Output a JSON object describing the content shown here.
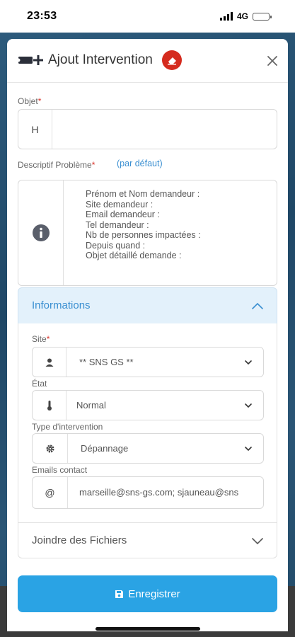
{
  "status_bar": {
    "time": "23:53",
    "network": "4G",
    "icons": [
      "signal-icon",
      "battery-icon"
    ]
  },
  "modal": {
    "title": "Ajout Intervention",
    "icons": [
      "ticket-add-icon",
      "eraser-icon",
      "close-icon"
    ],
    "objet": {
      "label": "Objet",
      "required_mark": "*",
      "addon_text": "H",
      "value": ""
    },
    "descriptif": {
      "label": "Descriptif Problème",
      "required_mark": "*",
      "default_link": "(par défaut)",
      "icon": "info-icon",
      "lines": [
        "Prénom et Nom demandeur :",
        "Site demandeur :",
        "Email demandeur :",
        "Tel demandeur :",
        "Nb de personnes impactées :",
        "Depuis quand :",
        "Objet détaillé demande :"
      ]
    },
    "informations": {
      "title": "Informations",
      "icon": "chevron-up-icon",
      "site": {
        "label": "Site",
        "required_mark": "*",
        "icon": "user-icon",
        "value": "** SNS GS **"
      },
      "etat": {
        "label": "État",
        "icon": "thermometer-icon",
        "value": "Normal"
      },
      "type": {
        "label": "Type d'intervention",
        "icon": "gear-icon",
        "value": "Dépannage"
      },
      "emails": {
        "label": "Emails contact",
        "icon": "at-icon",
        "value": "marseille@sns-gs.com; sjauneau@sns"
      }
    },
    "files": {
      "label": "Joindre des Fichiers",
      "icon": "chevron-down-icon"
    },
    "save_button": {
      "label": "Enregistrer",
      "icon": "save-icon"
    }
  },
  "colors": {
    "accent": "#2aa3e4",
    "link": "#3a8fd1",
    "required": "#d9342b",
    "badge": "#d52b1e",
    "section_bg": "#e3f1fb"
  }
}
